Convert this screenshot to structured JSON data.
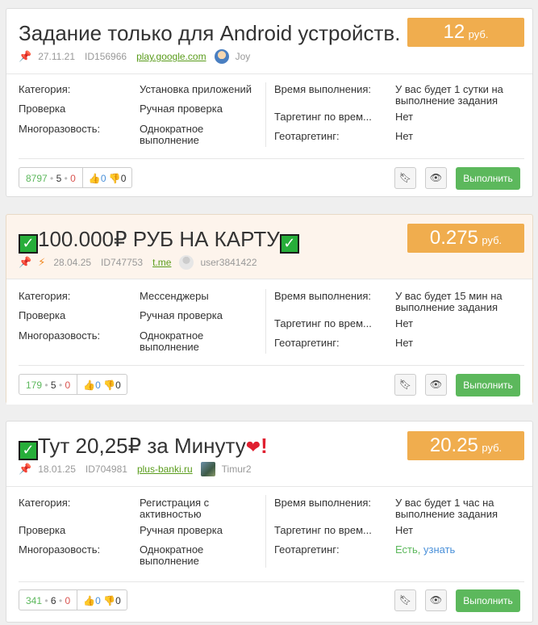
{
  "labels": {
    "category": "Категория:",
    "check": "Проверка",
    "repeat": "Многоразовость:",
    "time": "Время выполнения:",
    "targeting_time": "Таргетинг по врем...",
    "geo": "Геотаргетинг:",
    "do_button": "Выполнить",
    "currency": "руб."
  },
  "colors": {
    "price_bg": "#f0ad4e",
    "do_btn": "#5cb85c",
    "link_green": "#5a9c1c"
  },
  "tasks": [
    {
      "title": "Задание только для Android устройств.",
      "price": "12",
      "date": "27.11.21",
      "id": "ID156966",
      "domain": "play.google.com",
      "user": "Joy",
      "category": "Установка приложений",
      "check": "Ручная проверка",
      "repeat": "Однократное выполнение",
      "time": "У вас будет 1 сутки на выполнение задания",
      "targeting_time": "Нет",
      "geo": "Нет",
      "views": "8797",
      "done": "5",
      "rejected": "0",
      "likes": "0",
      "dislikes": "0"
    },
    {
      "title": "100.000₽ РУБ НА КАРТУ",
      "price": "0.275",
      "date": "28.04.25",
      "id": "ID747753",
      "domain": "t.me",
      "user": "user3841422",
      "category": "Мессенджеры",
      "check": "Ручная проверка",
      "repeat": "Однократное выполнение",
      "time": "У вас будет 15 мин на выполнение задания",
      "targeting_time": "Нет",
      "geo": "Нет",
      "views": "179",
      "done": "5",
      "rejected": "0",
      "likes": "0",
      "dislikes": "0"
    },
    {
      "title": "Тут 20,25₽ за Минуту",
      "price": "20.25",
      "date": "18.01.25",
      "id": "ID704981",
      "domain": "plus-banki.ru",
      "user": "Timur2",
      "category": "Регистрация с активностью",
      "check": "Ручная проверка",
      "repeat": "Однократное выполнение",
      "time": "У вас будет 1 час на выполнение задания",
      "targeting_time": "Нет",
      "geo_yes": "Есть,",
      "geo_link": "узнать",
      "views": "341",
      "done": "6",
      "rejected": "0",
      "likes": "0",
      "dislikes": "0"
    }
  ]
}
